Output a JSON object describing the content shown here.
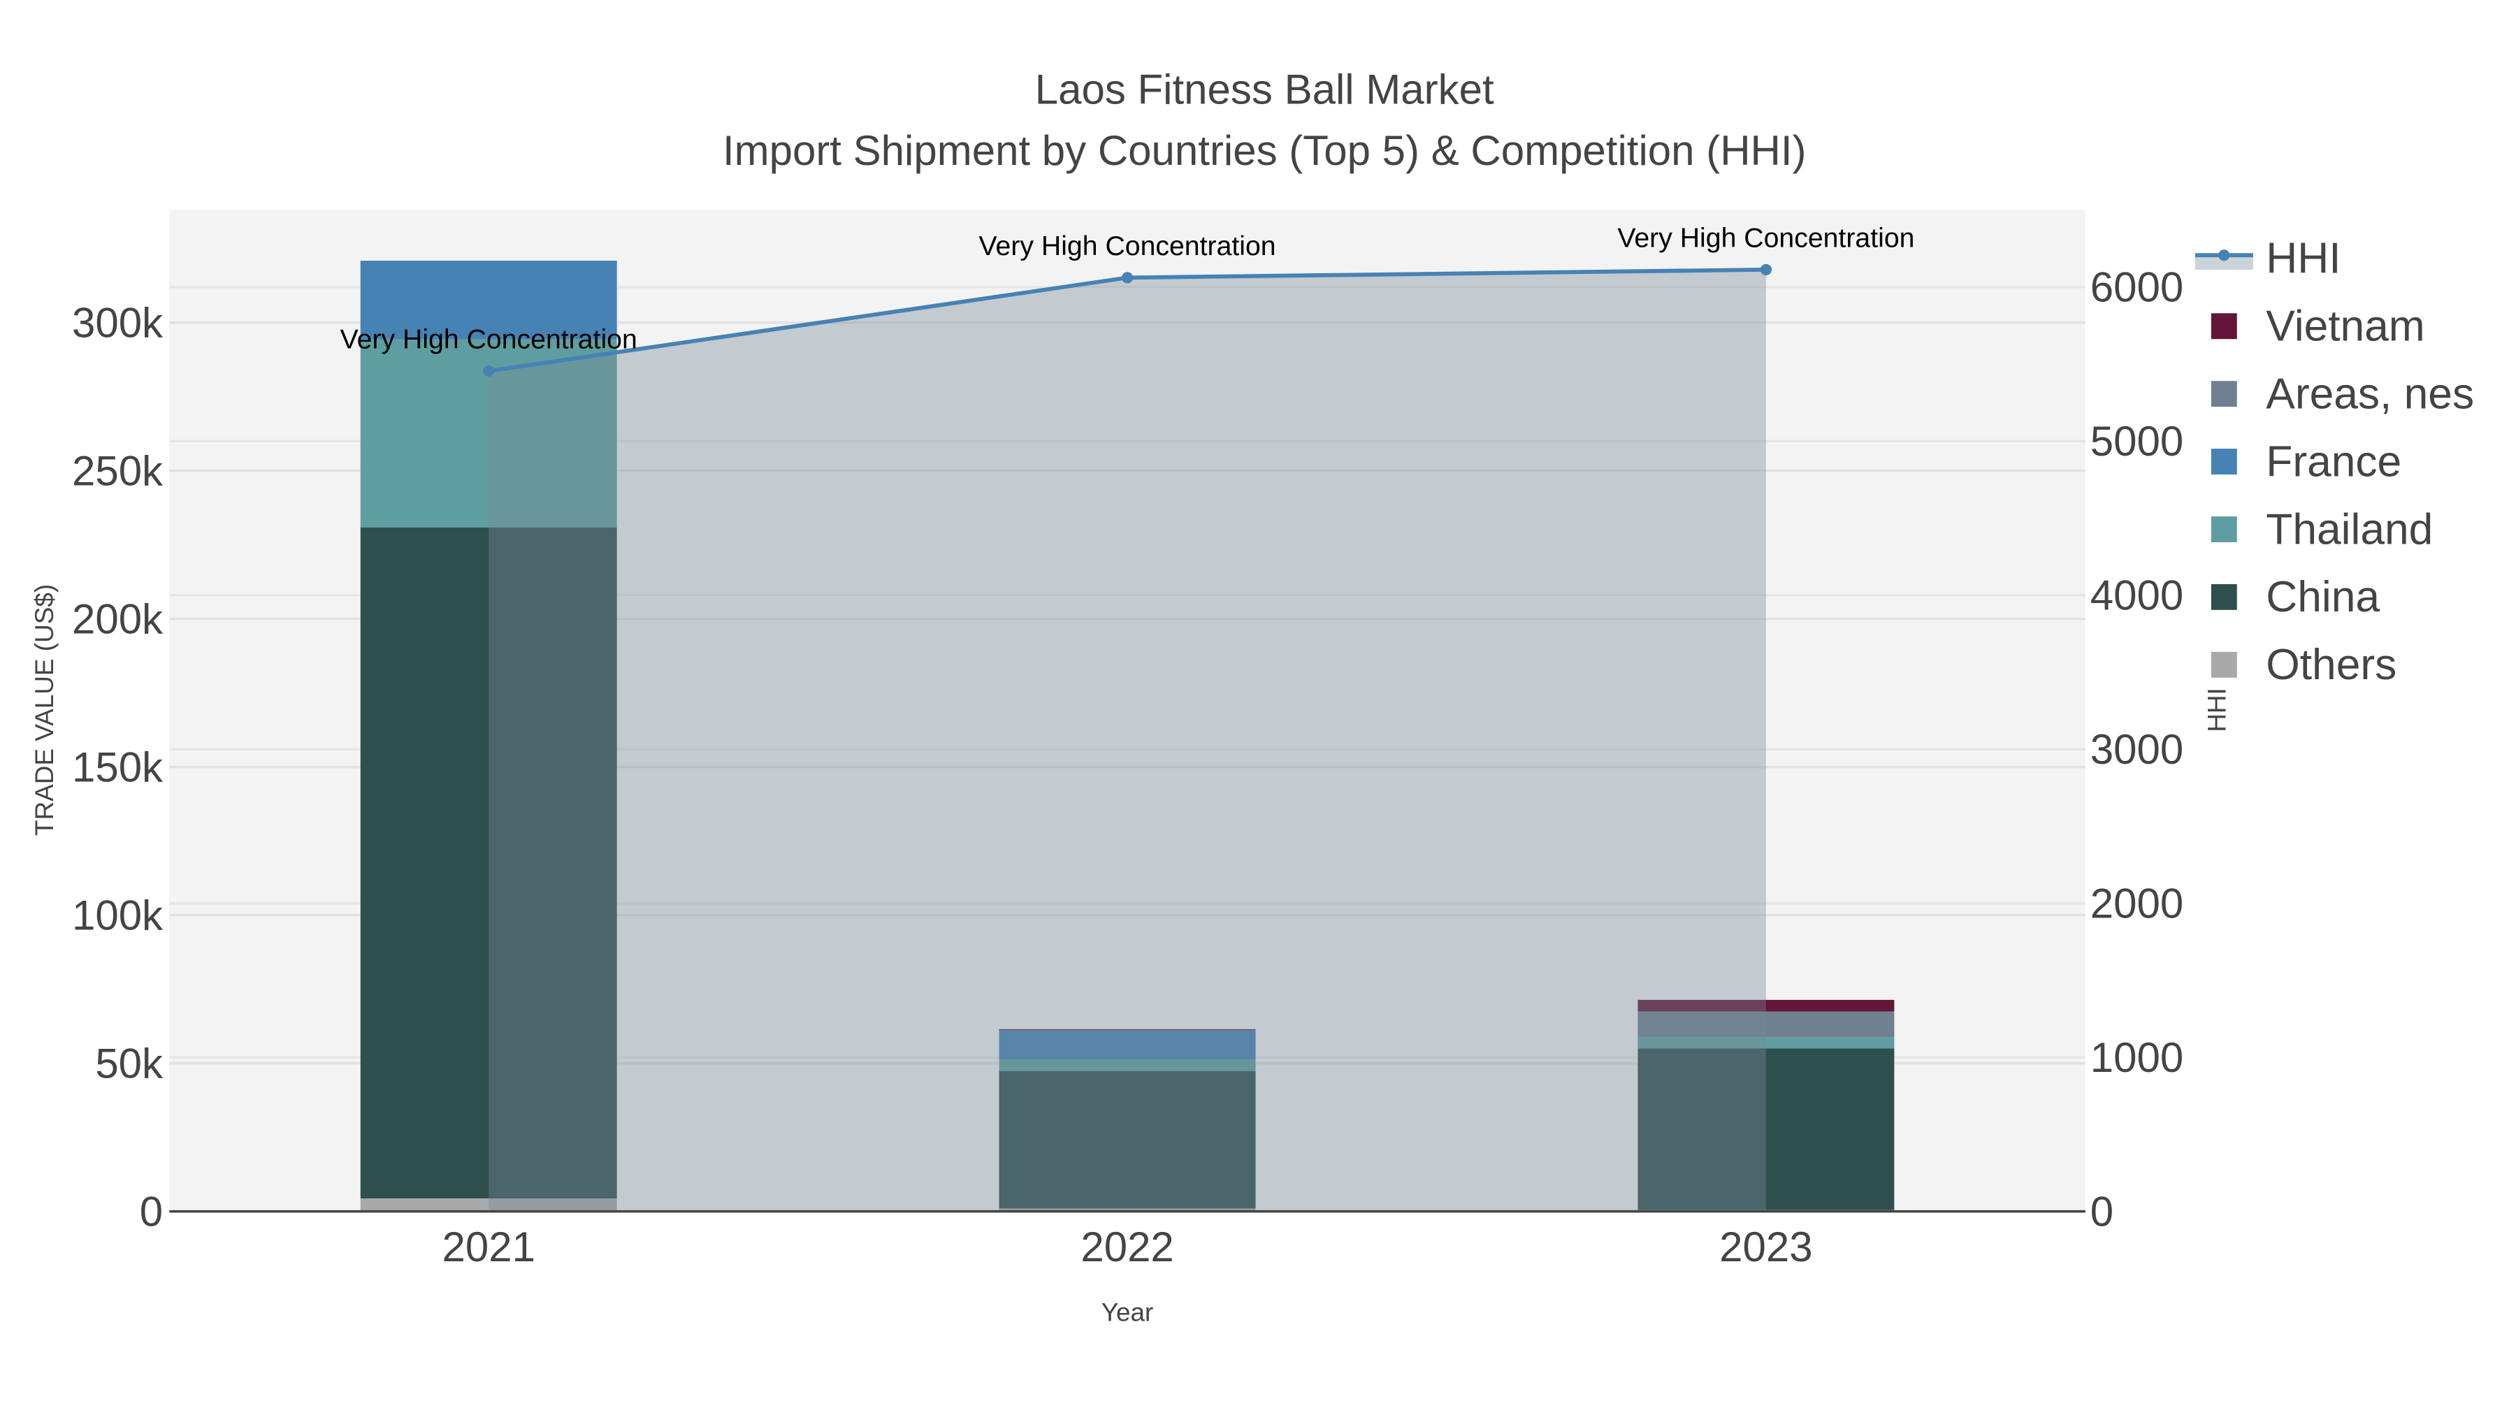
{
  "chart_data": {
    "type": "bar",
    "title": "Laos Fitness Ball Market",
    "subtitle": "Import Shipment by Countries (Top 5) & Competition (HHI)",
    "xlabel": "Year",
    "ylabel": "TRADE VALUE (US$)",
    "y2label": "HHI",
    "categories": [
      "2021",
      "2022",
      "2023"
    ],
    "ylim": [
      0,
      338000
    ],
    "y2lim": [
      0,
      6500
    ],
    "yticks": [
      0,
      50000,
      100000,
      150000,
      200000,
      250000,
      300000
    ],
    "ytick_labels": [
      "0",
      "50k",
      "100k",
      "150k",
      "200k",
      "250k",
      "300k"
    ],
    "y2ticks": [
      0,
      1000,
      2000,
      3000,
      4000,
      5000,
      6000
    ],
    "y2tick_labels": [
      "0",
      "1000",
      "2000",
      "3000",
      "4000",
      "5000",
      "6000"
    ],
    "barmode": "stack",
    "series": [
      {
        "name": "Others",
        "color": "#A9A9A9",
        "values": [
          4400,
          1000,
          500
        ]
      },
      {
        "name": "China",
        "color": "#2F4F4F",
        "values": [
          226500,
          46400,
          54500
        ]
      },
      {
        "name": "Thailand",
        "color": "#5F9EA0",
        "values": [
          63500,
          3800,
          3800
        ]
      },
      {
        "name": "France",
        "color": "#4682B4",
        "values": [
          26500,
          10000,
          0
        ]
      },
      {
        "name": "Areas, nes",
        "color": "#708090",
        "values": [
          0,
          0,
          8700
        ]
      },
      {
        "name": "Vietnam",
        "color": "#641638",
        "values": [
          0,
          300,
          3900
        ]
      }
    ],
    "hhi": {
      "name": "HHI",
      "color": "#4682B4",
      "values": [
        5455,
        6061,
        6113
      ],
      "annotations": [
        "Very High Concentration",
        "Very High Concentration",
        "Very High Concentration"
      ]
    },
    "legend_order": [
      "HHI",
      "Vietnam",
      "Areas, nes",
      "France",
      "Thailand",
      "China",
      "Others"
    ],
    "legend_position": "top-right",
    "grid": true
  }
}
